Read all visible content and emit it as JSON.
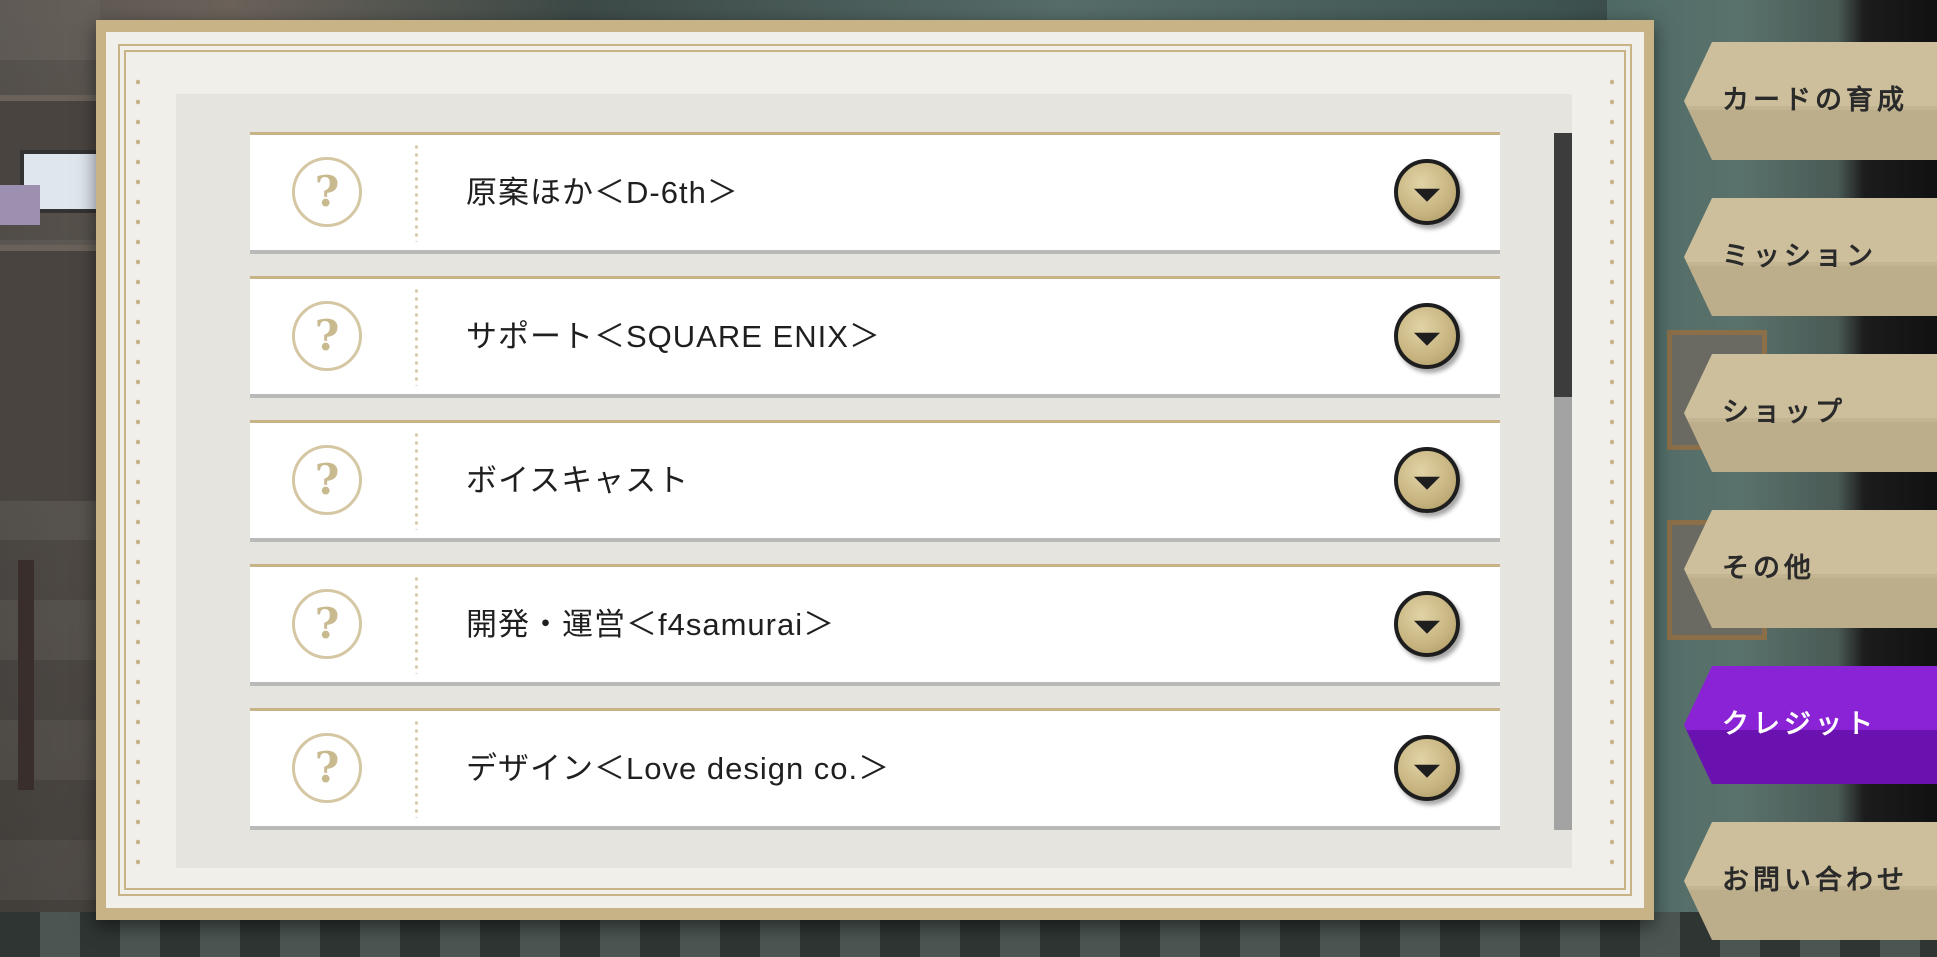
{
  "credits": {
    "rows": [
      {
        "label": "原案ほか＜D-6th＞"
      },
      {
        "label": "サポート＜SQUARE ENIX＞"
      },
      {
        "label": "ボイスキャスト"
      },
      {
        "label": "開発・運営＜f4samurai＞"
      },
      {
        "label": "デザイン＜Love design co.＞"
      }
    ],
    "help_glyph": "?"
  },
  "side_tabs": [
    {
      "label": "カードの育成",
      "active": false
    },
    {
      "label": "ミッション",
      "active": false
    },
    {
      "label": "ショップ",
      "active": false
    },
    {
      "label": "その他",
      "active": false
    },
    {
      "label": "クレジット",
      "active": true
    },
    {
      "label": "お問い合わせ",
      "active": false
    }
  ],
  "colors": {
    "accent_active_tab": "#8a22d6",
    "panel_gold": "#c7b386",
    "tab_beige": "#cdbf9c"
  },
  "icons": {
    "row_left": "question-mark-icon",
    "row_right": "chevron-down-icon"
  },
  "scroll": {
    "thumb_fraction": 0.38,
    "position_fraction": 0.0
  }
}
